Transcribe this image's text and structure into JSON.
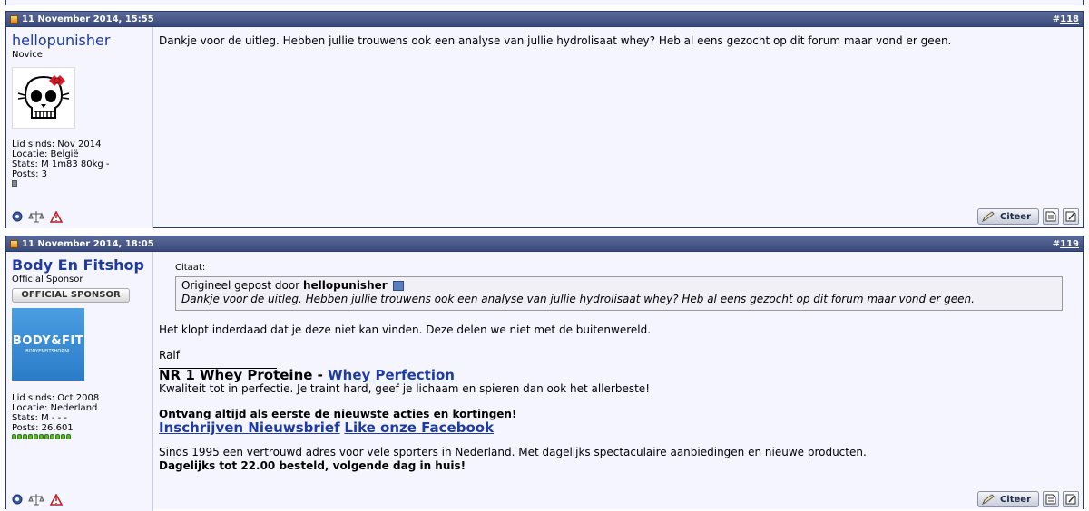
{
  "posts": [
    {
      "date": "11 November 2014, 15:55",
      "number": "118",
      "user": {
        "name": "hellopunisher",
        "title": "Novice",
        "joined": "Lid sinds: Nov 2014",
        "location": "Locatie: België",
        "stats": "Stats: M 1m83 80kg -",
        "posts": "Posts: 3"
      },
      "message": "Dankje voor de uitleg. Hebben jullie trouwens ook een analyse van jullie hydrolisaat whey? Heb al eens gezocht op dit forum maar vond er geen.",
      "quote_button": "Citeer"
    },
    {
      "date": "11 November 2014, 18:05",
      "number": "119",
      "user": {
        "name": "Body En Fitshop",
        "title": "Official Sponsor",
        "badge": "OFFICIAL SPONSOR",
        "avatar_text": "BODY&FIT",
        "avatar_sub": "BODYENFITSHOP.NL",
        "joined": "Lid sinds: Oct 2008",
        "location": "Locatie: Nederland",
        "stats": "Stats: M - - -",
        "posts": "Posts: 26.601"
      },
      "quote": {
        "label": "Citaat:",
        "prefix": "Origineel gepost door",
        "author": "hellopunisher",
        "text": "Dankje voor de uitleg. Hebben jullie trouwens ook een analyse van jullie hydrolisaat whey? Heb al eens gezocht op dit forum maar vond er geen."
      },
      "reply": "Het klopt inderdaad dat je deze niet kan vinden. Deze delen we niet met de buitenwereld.",
      "signoff": "Ralf",
      "signature": {
        "headline": "NR 1 Whey Proteine - ",
        "headline_link": "Whey Perfection",
        "tagline": "Kwaliteit tot in perfectie. Je traint hard, geef je lichaam en spieren dan ook het allerbeste!",
        "promo": "Ontvang altijd als eerste de nieuwste acties en kortingen!",
        "link1": "Inschrijven Nieuwsbrief",
        "link2": "Like onze Facebook",
        "about": "Sinds 1995 een vertrouwd adres voor vele sporters in Nederland. Met dagelijks spectaculaire aanbiedingen en nieuwe producten.",
        "delivery": "Dagelijks tot 22.00 besteld, volgende dag in huis!"
      },
      "quote_button": "Citeer"
    }
  ]
}
